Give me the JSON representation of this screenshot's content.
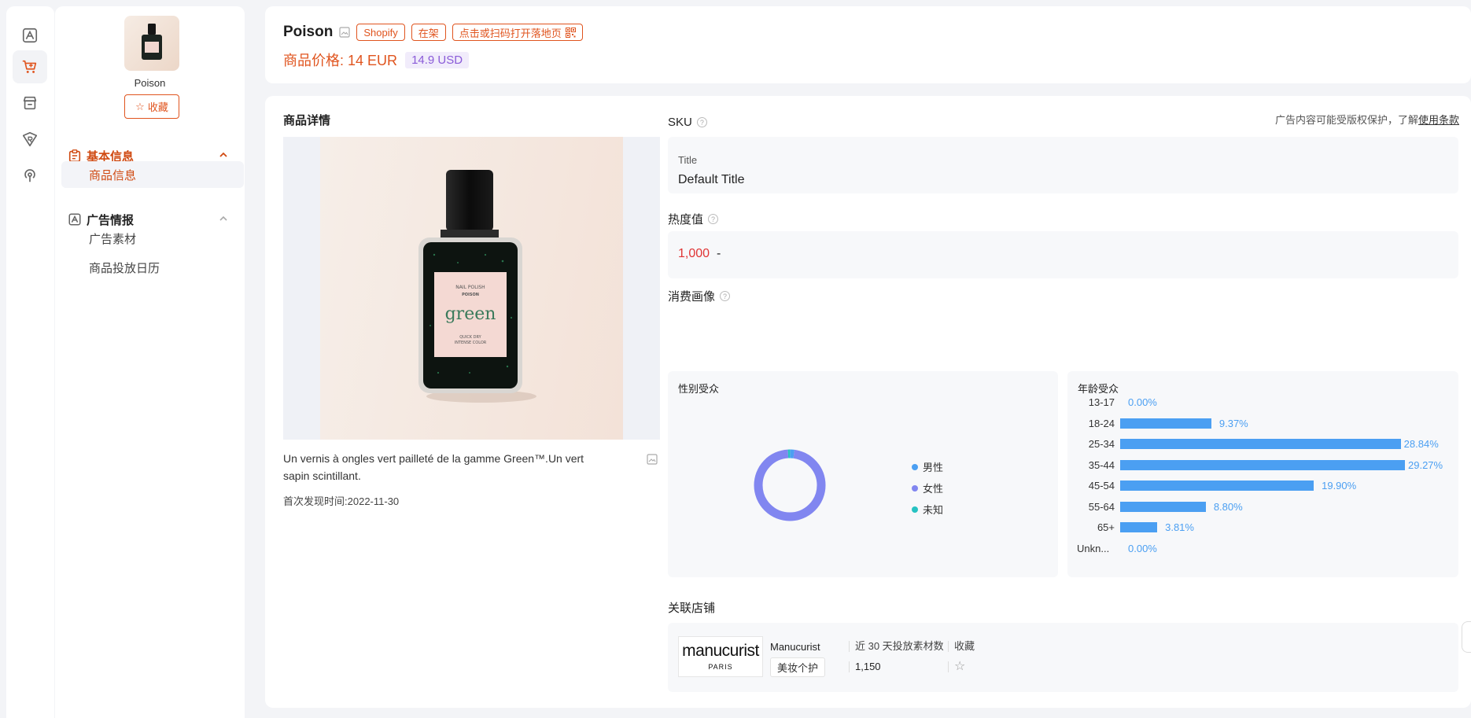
{
  "rail": {
    "items": [
      {
        "icon": "ad-library-icon"
      },
      {
        "icon": "cart-icon",
        "active": true
      },
      {
        "icon": "store-icon"
      },
      {
        "icon": "brand-icon"
      },
      {
        "icon": "broadcast-icon"
      }
    ]
  },
  "sidebar": {
    "product_name": "Poison",
    "favorite_label": "收藏",
    "groups": [
      {
        "label": "基本信息",
        "items": [
          {
            "label": "商品信息",
            "active": true
          }
        ]
      },
      {
        "label": "广告情报",
        "items": [
          {
            "label": "广告素材"
          },
          {
            "label": "商品投放日历"
          }
        ]
      }
    ]
  },
  "header": {
    "title": "Poison",
    "tags": [
      "Shopify",
      "在架",
      "点击或扫码打开落地页"
    ],
    "price_label": "商品价格:",
    "price_value": "14 EUR",
    "price_usd": "14.9 USD"
  },
  "details": {
    "section_title": "商品详情",
    "copyright_text": "广告内容可能受版权保护，了解",
    "copyright_link": "使用条款",
    "image_label_top": "NAIL POLISH",
    "image_label_brand": "POISON",
    "image_label_color": "green",
    "image_label_bottom1": "QUICK DRY",
    "image_label_bottom2": "INTENSE COLOR",
    "description": "Un vernis à ongles vert pailleté de la gamme Green™.Un vert sapin scintillant.",
    "first_seen_label": "首次发现时间:",
    "first_seen_value": "2022-11-30",
    "sku_title": "SKU",
    "sku_label": "Title",
    "sku_value": "Default Title",
    "heat_title": "热度值",
    "heat_value": "1,000",
    "heat_dash": "-",
    "audience_title": "消费画像",
    "gender_title": "性别受众",
    "gender": [
      {
        "label": "男性",
        "color": "#4b9ff2",
        "share": 0.02
      },
      {
        "label": "女性",
        "color": "#8186f0",
        "share": 0.97
      },
      {
        "label": "未知",
        "color": "#26c2c2",
        "share": 0.01
      }
    ],
    "age_title": "年龄受众",
    "age": [
      {
        "label": "13-17",
        "pct": "0.00%",
        "value": 0.0
      },
      {
        "label": "18-24",
        "pct": "9.37%",
        "value": 9.37
      },
      {
        "label": "25-34",
        "pct": "28.84%",
        "value": 28.84
      },
      {
        "label": "35-44",
        "pct": "29.27%",
        "value": 29.27
      },
      {
        "label": "45-54",
        "pct": "19.90%",
        "value": 19.9
      },
      {
        "label": "55-64",
        "pct": "8.80%",
        "value": 8.8
      },
      {
        "label": "65+",
        "pct": "3.81%",
        "value": 3.81
      },
      {
        "label": "Unkn...",
        "pct": "0.00%",
        "value": 0.0
      }
    ],
    "store_title": "关联店铺",
    "store": {
      "logo_main": "manucurist",
      "logo_sub": "PARIS",
      "name": "Manucurist",
      "category": "美妆个护",
      "ads_label": "近 30 天投放素材数",
      "ads_value": "1,150",
      "fav_label": "收藏"
    }
  }
}
